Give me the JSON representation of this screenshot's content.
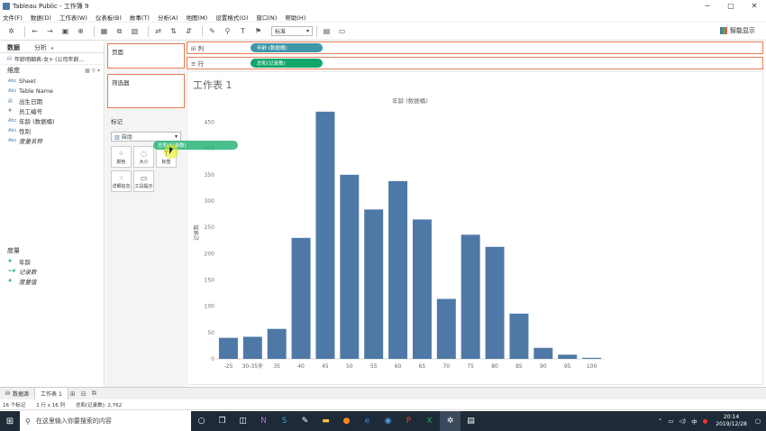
{
  "window": {
    "title": "Tableau Public - 工作簿 9",
    "minimize": "─",
    "maximize": "▢",
    "close": "✕"
  },
  "menu": [
    "文件(F)",
    "数据(D)",
    "工作表(W)",
    "仪表板(B)",
    "故事(T)",
    "分析(A)",
    "地图(M)",
    "设置格式(O)",
    "窗口(N)",
    "帮助(H)"
  ],
  "toolbar": {
    "fit_select": "标准",
    "show_me": "智能显示"
  },
  "data_pane": {
    "tab_data": "数据",
    "tab_analysis": "分析",
    "datasource": "年龄明细表-女+ (公司年龄...",
    "dimensions_title": "维度",
    "dimensions": [
      {
        "icon": "Abc",
        "name": "Sheet",
        "italic": false
      },
      {
        "icon": "Abc",
        "name": "Table Name",
        "italic": false
      },
      {
        "icon": "▤",
        "name": "出生日期",
        "italic": false
      },
      {
        "icon": "#",
        "name": "员工编号",
        "italic": false
      },
      {
        "icon": "Abc",
        "name": "年龄 (数据桶)",
        "italic": false
      },
      {
        "icon": "Abc",
        "name": "性别",
        "italic": false
      },
      {
        "icon": "Abc",
        "name": "度量名称",
        "italic": true
      }
    ],
    "measures_title": "度量",
    "measures": [
      {
        "icon": "#",
        "name": "年龄",
        "italic": false
      },
      {
        "icon": "=#",
        "name": "记录数",
        "italic": true
      },
      {
        "icon": "#",
        "name": "度量值",
        "italic": true
      }
    ]
  },
  "shelves": {
    "pages": "页面",
    "filters": "筛选器",
    "marks": "标记",
    "mark_type": "自动",
    "mark_buttons": [
      {
        "icon": "⁘",
        "label": "颜色"
      },
      {
        "icon": "◌",
        "label": "大小"
      },
      {
        "icon": "T",
        "label": "标签"
      },
      {
        "icon": "⁖",
        "label": "详细信息"
      },
      {
        "icon": "▭",
        "label": "工具提示"
      }
    ],
    "drag_pill": "总和(记录数)",
    "columns_label": "iii 列",
    "rows_label": "≡ 行",
    "columns_pill": "年龄 (数据桶)",
    "rows_pill": "总和(记录数)"
  },
  "sheet": {
    "title": "工作表 1"
  },
  "chart_data": {
    "type": "bar",
    "title": "年龄 (数据桶)",
    "ylabel": "记录数",
    "xlabel": "",
    "categories": [
      "-25",
      "30-35岁",
      "35",
      "40",
      "45",
      "50",
      "55",
      "60",
      "65",
      "70",
      "75",
      "80",
      "85",
      "90",
      "95",
      "100"
    ],
    "values": [
      40,
      42,
      57,
      230,
      470,
      350,
      284,
      338,
      265,
      114,
      236,
      213,
      86,
      21,
      8,
      2
    ],
    "ylim": [
      0,
      480
    ],
    "yticks": [
      0,
      50,
      100,
      150,
      200,
      250,
      300,
      350,
      400,
      450
    ],
    "bar_color": "#4e79a7",
    "grid": false
  },
  "sheet_tabs": {
    "datasource": "数据源",
    "sheet1": "工作表 1"
  },
  "status": {
    "marks": "16 个标记",
    "rows_cols": "1 行 x 16 列",
    "sum": "总和(记录数): 2,762"
  },
  "taskbar": {
    "search_placeholder": "在这里输入你要搜索的内容",
    "ime": "中",
    "time": "20:14",
    "date": "2019/12/28"
  }
}
